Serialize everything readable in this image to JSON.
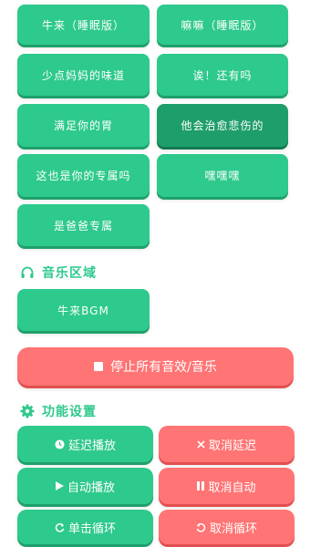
{
  "sounds": [
    {
      "label": "牛来（睡眠版）"
    },
    {
      "label": "嘛嘛（睡眠版）"
    },
    {
      "label": "少点妈妈的味道"
    },
    {
      "label": "诶！还有吗"
    },
    {
      "label": "满足你的胃"
    },
    {
      "label": "他会治愈悲伤的"
    },
    {
      "label": "这也是你的专属吗"
    },
    {
      "label": "嘿嘿嘿"
    },
    {
      "label": "是爸爸专属"
    }
  ],
  "music_section": {
    "title": "音乐区域",
    "icon": "headphones-icon"
  },
  "music": [
    {
      "label": "牛来BGM"
    }
  ],
  "stop_all": {
    "label": "停止所有音效/音乐",
    "icon": "stop-square-icon"
  },
  "settings_section": {
    "title": "功能设置",
    "icon": "gear-icon"
  },
  "settings": {
    "delay_play": {
      "label": "延迟播放",
      "icon": "clock-icon"
    },
    "cancel_delay": {
      "label": "取消延迟",
      "icon": "close-icon"
    },
    "auto_play": {
      "label": "自动播放",
      "icon": "play-icon"
    },
    "cancel_auto": {
      "label": "取消自动",
      "icon": "pause-icon"
    },
    "single_loop": {
      "label": "单击循环",
      "icon": "loop-icon"
    },
    "cancel_loop": {
      "label": "取消循环",
      "icon": "undo-icon"
    }
  },
  "colors": {
    "green": "#2ec98c",
    "dark_green": "#1e9e6a",
    "red": "#ff7474"
  }
}
